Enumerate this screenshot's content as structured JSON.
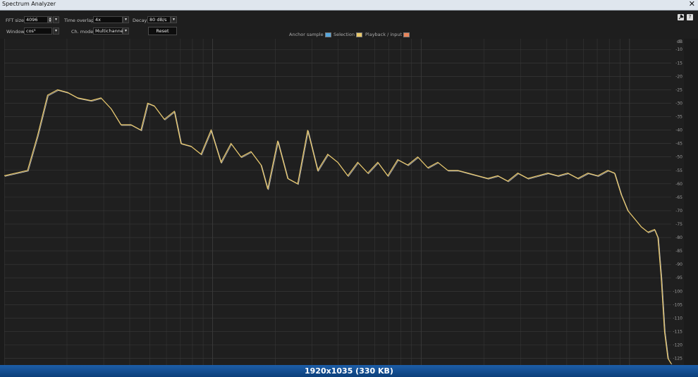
{
  "window": {
    "title": "Spectrum Analyzer",
    "close_glyph": "✕"
  },
  "toolbar": {
    "fft_size": {
      "label": "FFT size",
      "value": "4096"
    },
    "time_overlap": {
      "label": "Time overlap",
      "value": "4x"
    },
    "decay": {
      "label": "Decay",
      "value": "80 dB/s"
    },
    "window": {
      "label": "Window",
      "value": "cos³"
    },
    "ch_mode": {
      "label": "Ch. mode",
      "value": "Multichannel"
    },
    "reset_label": "Reset",
    "legend": [
      {
        "label": "Anchor sample",
        "color": "#56a6dc"
      },
      {
        "label": "Selection",
        "color": "#e9c86a"
      },
      {
        "label": "Playback / input",
        "color": "#e8845a"
      }
    ],
    "icons": [
      "pin-icon",
      "help-icon"
    ],
    "help_glyph": "?"
  },
  "status_bar": {
    "text": "1920x1035 (330 KB)"
  },
  "chart_data": {
    "type": "line",
    "title": "",
    "xlabel": "",
    "ylabel": "",
    "y_axis_label": "dB",
    "y_ticks": [
      -10,
      -15,
      -20,
      -25,
      -30,
      -35,
      -40,
      -45,
      -50,
      -55,
      -60,
      -65,
      -70,
      -75,
      -80,
      -85,
      -90,
      -95,
      -100,
      -105,
      -110,
      -115,
      -120,
      -125
    ],
    "ylim": [
      -128,
      -6
    ],
    "x_scale": "log",
    "grid": true,
    "series": [
      {
        "color": "#e9c86a",
        "points": [
          [
            0.0,
            -57
          ],
          [
            0.035,
            -55
          ],
          [
            0.05,
            -42
          ],
          [
            0.065,
            -27
          ],
          [
            0.08,
            -25
          ],
          [
            0.095,
            -26
          ],
          [
            0.11,
            -28
          ],
          [
            0.13,
            -29
          ],
          [
            0.145,
            -28
          ],
          [
            0.16,
            -32
          ],
          [
            0.175,
            -38
          ],
          [
            0.19,
            -38
          ],
          [
            0.205,
            -40
          ],
          [
            0.215,
            -30
          ],
          [
            0.225,
            -31
          ],
          [
            0.24,
            -36
          ],
          [
            0.255,
            -33
          ],
          [
            0.265,
            -45
          ],
          [
            0.28,
            -46
          ],
          [
            0.295,
            -49
          ],
          [
            0.31,
            -40
          ],
          [
            0.325,
            -52
          ],
          [
            0.34,
            -45
          ],
          [
            0.355,
            -50
          ],
          [
            0.37,
            -48
          ],
          [
            0.385,
            -53
          ],
          [
            0.395,
            -62
          ],
          [
            0.41,
            -44
          ],
          [
            0.425,
            -58
          ],
          [
            0.44,
            -60
          ],
          [
            0.455,
            -40
          ],
          [
            0.47,
            -55
          ],
          [
            0.485,
            -49
          ],
          [
            0.5,
            -52
          ],
          [
            0.515,
            -57
          ],
          [
            0.53,
            -52
          ],
          [
            0.545,
            -56
          ],
          [
            0.56,
            -52
          ],
          [
            0.575,
            -57
          ],
          [
            0.59,
            -51
          ],
          [
            0.605,
            -53
          ],
          [
            0.62,
            -50
          ],
          [
            0.635,
            -54
          ],
          [
            0.65,
            -52
          ],
          [
            0.665,
            -55
          ],
          [
            0.68,
            -55
          ],
          [
            0.695,
            -56
          ],
          [
            0.71,
            -57
          ],
          [
            0.725,
            -58
          ],
          [
            0.74,
            -57
          ],
          [
            0.755,
            -59
          ],
          [
            0.77,
            -56
          ],
          [
            0.785,
            -58
          ],
          [
            0.8,
            -57
          ],
          [
            0.815,
            -56
          ],
          [
            0.83,
            -57
          ],
          [
            0.845,
            -56
          ],
          [
            0.86,
            -58
          ],
          [
            0.875,
            -56
          ],
          [
            0.89,
            -57
          ],
          [
            0.905,
            -55
          ],
          [
            0.915,
            -56
          ],
          [
            0.925,
            -64
          ],
          [
            0.935,
            -70
          ],
          [
            0.945,
            -73
          ],
          [
            0.955,
            -76
          ],
          [
            0.965,
            -78
          ],
          [
            0.975,
            -77
          ],
          [
            0.98,
            -80
          ],
          [
            0.985,
            -95
          ],
          [
            0.99,
            -115
          ],
          [
            0.995,
            -125
          ],
          [
            1.0,
            -127
          ]
        ]
      }
    ]
  }
}
